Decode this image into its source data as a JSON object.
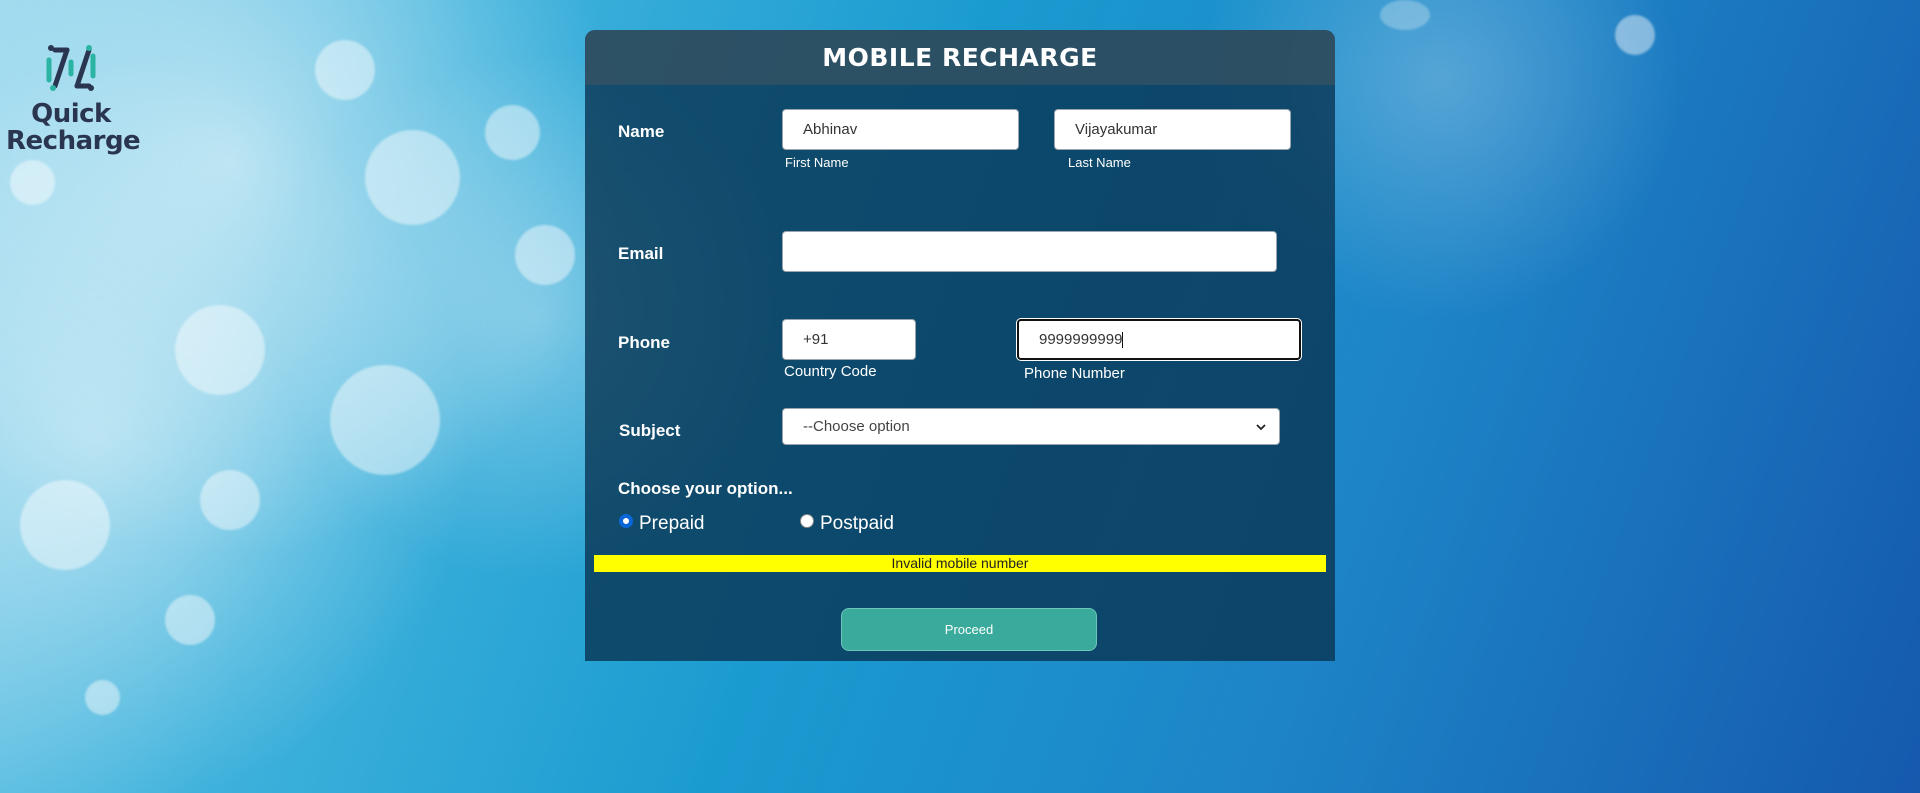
{
  "brand": {
    "logo_line1": "Quick",
    "logo_line2": "Recharge",
    "logo_color": "#2a3550",
    "logo_accent": "#2bb3a3"
  },
  "form": {
    "title": "MOBILE RECHARGE",
    "name_label": "Name",
    "first_name_value": "Abhinav",
    "first_name_sublabel": "First Name",
    "last_name_value": "Vijayakumar",
    "last_name_sublabel": "Last Name",
    "email_label": "Email",
    "email_value": "",
    "phone_label": "Phone",
    "country_code_value": "+91",
    "country_code_sublabel": "Country Code",
    "phone_number_value": "9999999999",
    "phone_number_sublabel": "Phone Number",
    "subject_label": "Subject",
    "subject_selected": "--Choose option",
    "option_heading": "Choose your option...",
    "options": [
      {
        "label": "Prepaid",
        "checked": true
      },
      {
        "label": "Postpaid",
        "checked": false
      }
    ],
    "error_message": "Invalid mobile number",
    "proceed_label": "Proceed"
  },
  "colors": {
    "error_bg": "#ffff00",
    "proceed_bg": "#3aaa9c",
    "radio_selected": "#0a66d8"
  }
}
